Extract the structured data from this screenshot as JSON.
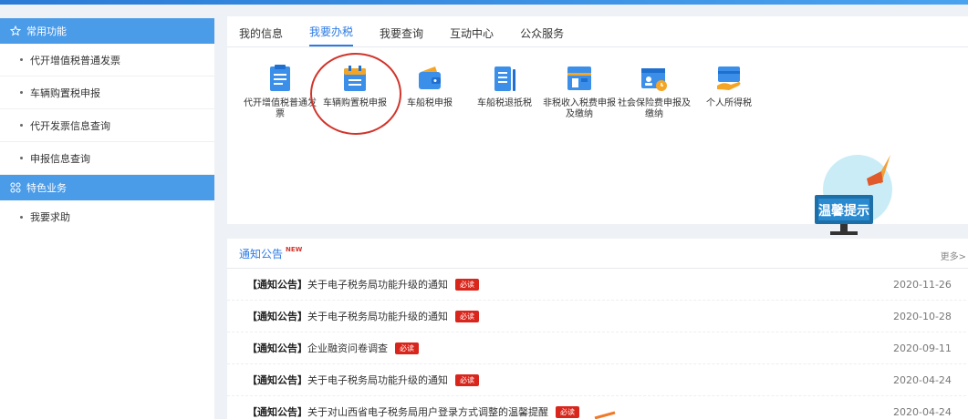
{
  "sidebar": {
    "sections": [
      {
        "title": "常用功能",
        "items": [
          "代开增值税普通发票",
          "车辆购置税申报",
          "代开发票信息查询",
          "申报信息查询"
        ]
      },
      {
        "title": "特色业务",
        "items": [
          "我要求助"
        ]
      }
    ]
  },
  "tabs": [
    {
      "label": "我的信息",
      "active": false
    },
    {
      "label": "我要办税",
      "active": true
    },
    {
      "label": "我要查询",
      "active": false
    },
    {
      "label": "互动中心",
      "active": false
    },
    {
      "label": "公众服务",
      "active": false
    }
  ],
  "tiles": [
    {
      "label": "代开增值税普通发票",
      "icon": "invoice-icon"
    },
    {
      "label": "车辆购置税申报",
      "icon": "vehicle-tax-icon"
    },
    {
      "label": "车船税申报",
      "icon": "wallet-icon"
    },
    {
      "label": "车船税退抵税",
      "icon": "refund-icon"
    },
    {
      "label": "非税收入税费申报及缴纳",
      "icon": "non-tax-icon"
    },
    {
      "label": "社会保险费申报及缴纳",
      "icon": "social-insurance-icon"
    },
    {
      "label": "个人所得税",
      "icon": "personal-tax-icon"
    }
  ],
  "tip": {
    "label": "温馨提示"
  },
  "notice": {
    "title": "通知公告",
    "badge": "NEW",
    "more": "更多>",
    "must_label": "必读",
    "rows": [
      {
        "category": "【通知公告】",
        "text": "关于电子税务局功能升级的通知",
        "date": "2020-11-26"
      },
      {
        "category": "【通知公告】",
        "text": "关于电子税务局功能升级的通知",
        "date": "2020-10-28"
      },
      {
        "category": "【通知公告】",
        "text": "企业融资问卷调查",
        "date": "2020-09-11"
      },
      {
        "category": "【通知公告】",
        "text": "关于电子税务局功能升级的通知",
        "date": "2020-04-24"
      },
      {
        "category": "【通知公告】",
        "text": "关于对山西省电子税务局用户登录方式调整的温馨提醒",
        "date": "2020-04-24"
      }
    ]
  },
  "colors": {
    "accent": "#2c7be5",
    "sidebar_header": "#4a9be8",
    "must": "#d9261c",
    "annotation": "#d0352c"
  }
}
